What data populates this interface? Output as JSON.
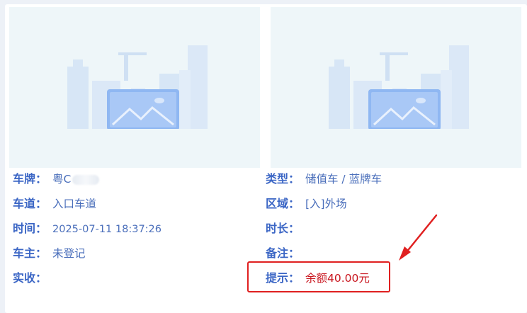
{
  "left_image": {
    "icon": "image-placeholder-icon"
  },
  "right_image": {
    "icon": "image-placeholder-icon"
  },
  "fields_left": {
    "plate_label": "车牌：",
    "plate_value": "粤C",
    "lane_label": "车道：",
    "lane_value": "入口车道",
    "time_label": "时间：",
    "time_value": "2025-07-11 18:37:26",
    "owner_label": "车主：",
    "owner_value": "未登记",
    "paid_label": "实收：",
    "paid_value": ""
  },
  "fields_right": {
    "type_label": "类型：",
    "type_value": "储值车 / 蓝牌车",
    "zone_label": "区域：",
    "zone_value": "[入]外场",
    "duration_label": "时长：",
    "duration_value": "",
    "note_label": "备注：",
    "note_value": "",
    "tip_label": "提示：",
    "tip_value": "余额40.00元"
  },
  "annotation": {
    "color": "#e02020"
  }
}
